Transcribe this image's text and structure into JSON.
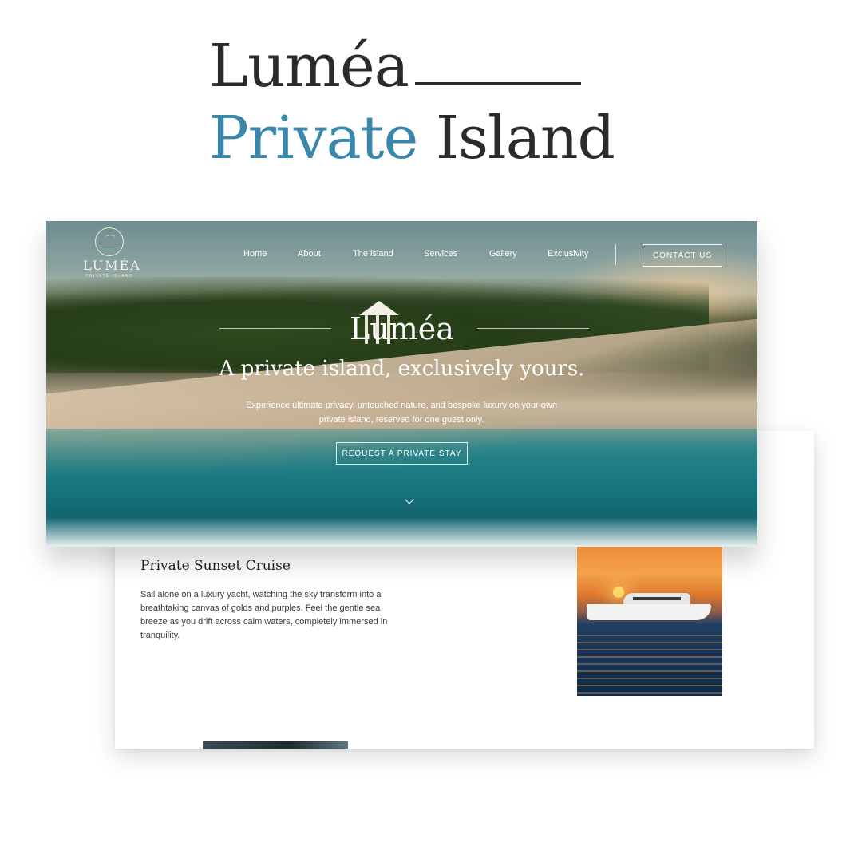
{
  "headline": {
    "line1": "Luméa",
    "line2_accent": "Private",
    "line2_rest": "Island",
    "accent_color": "#3a87ab"
  },
  "logo": {
    "name": "LUMÉA",
    "tagline": "PRIVATE ISLAND"
  },
  "nav": {
    "items": [
      "Home",
      "About",
      "The island",
      "Services",
      "Gallery",
      "Exclusivity"
    ],
    "contact_label": "CONTACT US"
  },
  "hero": {
    "title": "Luméa",
    "subtitle": "A private island, exclusively yours.",
    "description": "Experience ultimate privacy, untouched nature, and bespoke luxury on your own private island, reserved for one guest only.",
    "cta_label": "REQUEST A PRIVATE STAY",
    "scroll_icon": "chevron-down-icon"
  },
  "section": {
    "title": "Private Sunset Cruise",
    "body": "Sail alone on a luxury yacht, watching the sky transform into a breathtaking canvas of golds and purples. Feel the gentle sea breeze as you drift across calm waters, completely immersed in tranquility."
  }
}
